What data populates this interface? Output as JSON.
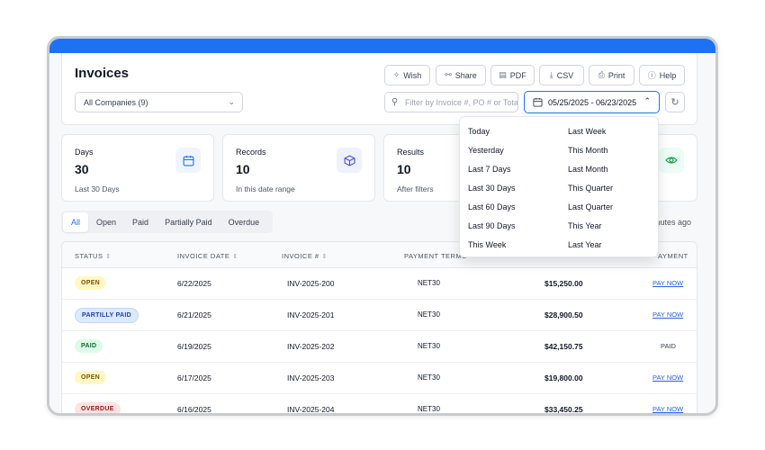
{
  "page": {
    "title": "Invoices",
    "company_select": "All Companies (9)",
    "filter_placeholder": "Filter by Invoice #, PO # or Total",
    "date_range": "05/25/2025 - 06/23/2025",
    "updated_text": "minutes ago"
  },
  "toolbar": [
    {
      "label": "Wish",
      "icon": "sparkle-icon"
    },
    {
      "label": "Share",
      "icon": "share-icon"
    },
    {
      "label": "PDF",
      "icon": "file-icon"
    },
    {
      "label": "CSV",
      "icon": "download-icon"
    },
    {
      "label": "Print",
      "icon": "printer-icon"
    },
    {
      "label": "Help",
      "icon": "help-icon"
    }
  ],
  "stats": [
    {
      "label": "Days",
      "value": "30",
      "sub": "Last 30 Days",
      "icon": "calendar-icon"
    },
    {
      "label": "Records",
      "value": "10",
      "sub": "In this date range",
      "icon": "box-icon"
    },
    {
      "label": "Results",
      "value": "10",
      "sub": "After filters",
      "icon": "eye-icon"
    }
  ],
  "tabs": [
    "All",
    "Open",
    "Paid",
    "Partially Paid",
    "Overdue"
  ],
  "date_options": {
    "left": [
      "Today",
      "Yesterday",
      "Last 7 Days",
      "Last 30 Days",
      "Last 60 Days",
      "Last 90 Days",
      "This Week"
    ],
    "right": [
      "Last Week",
      "This Month",
      "Last Month",
      "This Quarter",
      "Last Quarter",
      "This Year",
      "Last Year"
    ]
  },
  "table": {
    "headers": {
      "status": "STATUS",
      "date": "INVOICE DATE",
      "invoice": "INVOICE #",
      "terms": "PAYMENT TERMS",
      "payment": "AYMENT"
    },
    "rows": [
      {
        "status": "OPEN",
        "date": "6/22/2025",
        "invoice": "INV-2025-200",
        "terms": "NET30",
        "amount": "$15,250.00",
        "action": "PAY NOW"
      },
      {
        "status": "PARTILLY PAID",
        "date": "6/21/2025",
        "invoice": "INV-2025-201",
        "terms": "NET30",
        "amount": "$28,900.50",
        "action": "PAY NOW"
      },
      {
        "status": "PAID",
        "date": "6/19/2025",
        "invoice": "INV-2025-202",
        "terms": "NET30",
        "amount": "$42,150.75",
        "action": "PAID"
      },
      {
        "status": "OPEN",
        "date": "6/17/2025",
        "invoice": "INV-2025-203",
        "terms": "NET30",
        "amount": "$19,800.00",
        "action": "PAY NOW"
      },
      {
        "status": "OVERDUE",
        "date": "6/16/2025",
        "invoice": "INV-2025-204",
        "terms": "NET30",
        "amount": "$33,450.25",
        "action": "PAY NOW"
      }
    ]
  },
  "colors": {
    "accent": "#1d72f3",
    "open_bg": "#fef9c3",
    "open_fg": "#854d0e",
    "partial_bg": "#dbeafe",
    "partial_fg": "#1e40af",
    "paid_bg": "#dcfce7",
    "paid_fg": "#166534",
    "overdue_bg": "#fee2e2",
    "overdue_fg": "#991b1b"
  }
}
